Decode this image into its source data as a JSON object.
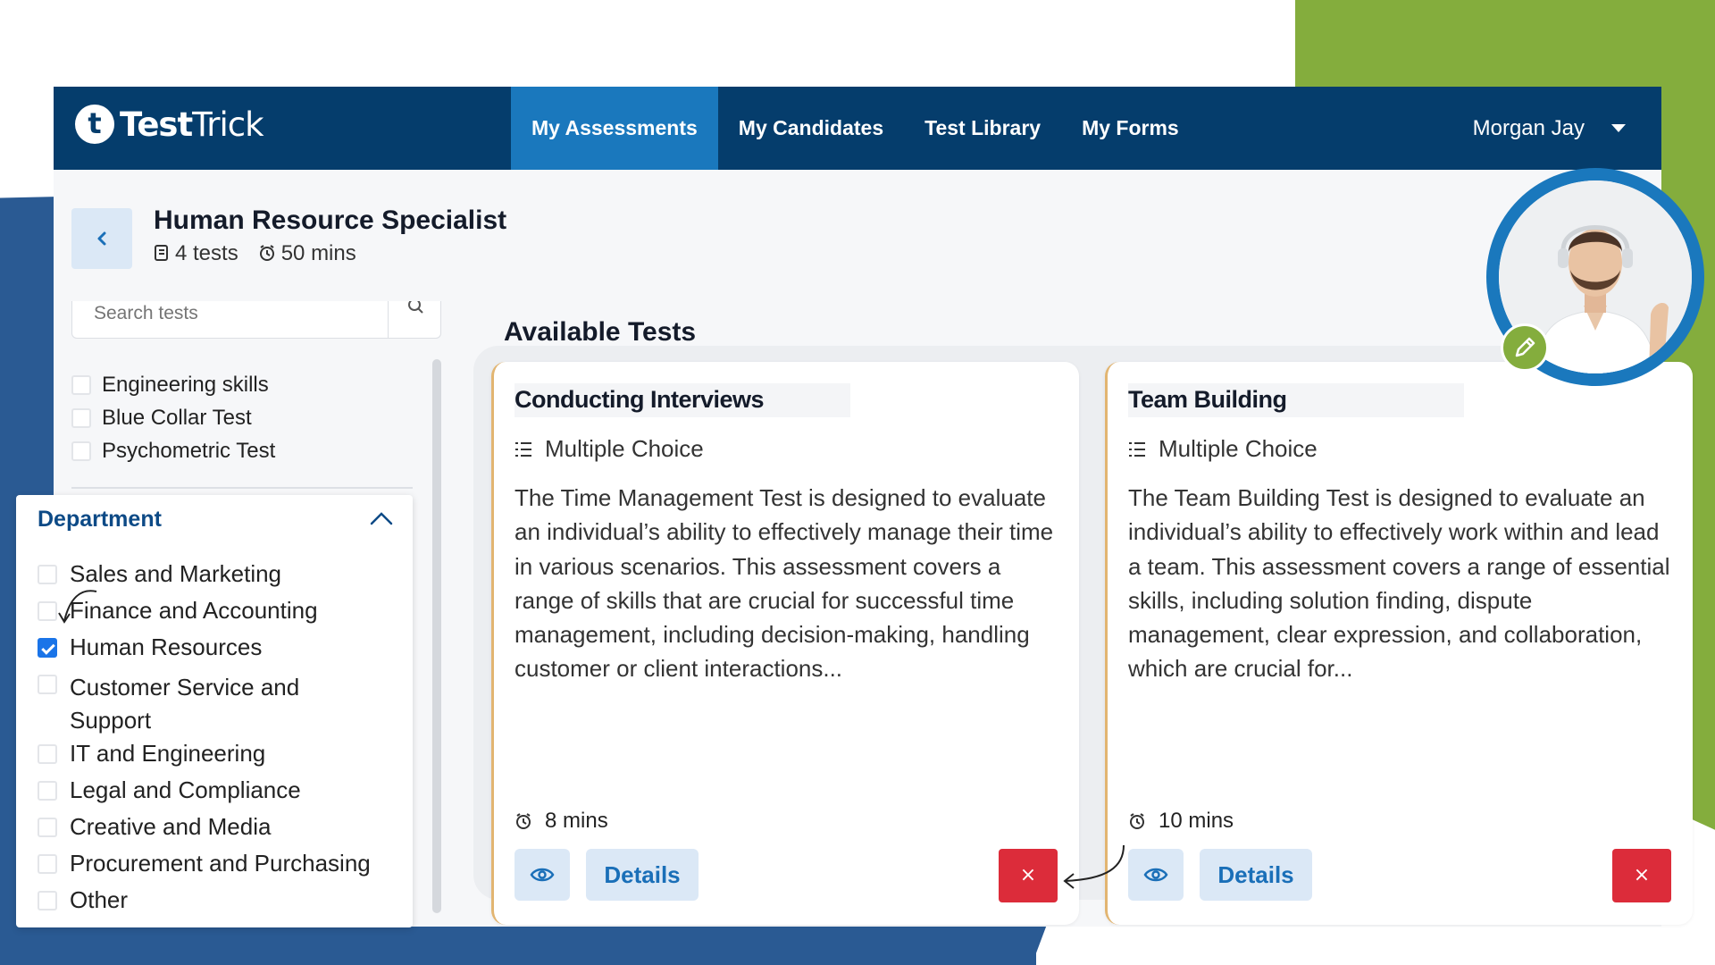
{
  "brand": {
    "logo_letter": "t",
    "name_bold": "Test",
    "name_rest": "Trick"
  },
  "nav": {
    "items": [
      {
        "label": "My Assessments",
        "active": true
      },
      {
        "label": "My Candidates",
        "active": false
      },
      {
        "label": "Test Library",
        "active": false
      },
      {
        "label": "My Forms",
        "active": false
      }
    ],
    "user_name": "Morgan Jay"
  },
  "header": {
    "title": "Human Resource Specialist",
    "tests_count": "4 tests",
    "duration": "50 mins"
  },
  "sidebar": {
    "search_placeholder": "Search tests",
    "test_types": [
      {
        "label": "Engineering skills",
        "checked": false
      },
      {
        "label": "Blue Collar Test",
        "checked": false
      },
      {
        "label": "Psychometric Test",
        "checked": false
      }
    ],
    "department": {
      "title": "Department",
      "items": [
        {
          "label": "Sales and Marketing",
          "checked": false
        },
        {
          "label": "Finance and Accounting",
          "checked": false
        },
        {
          "label": "Human Resources",
          "checked": true
        },
        {
          "label": "Customer Service and Support",
          "checked": false
        },
        {
          "label": "IT and Engineering",
          "checked": false
        },
        {
          "label": "Legal and Compliance",
          "checked": false
        },
        {
          "label": "Creative and Media",
          "checked": false
        },
        {
          "label": "Procurement and Purchasing",
          "checked": false
        },
        {
          "label": "Other",
          "checked": false
        }
      ]
    }
  },
  "main": {
    "section_title": "Available Tests",
    "cards": [
      {
        "title": "Conducting Interviews",
        "type": "Multiple Choice",
        "description": "The Time Management Test is designed to evaluate an individual’s ability to effectively manage their time in various scenarios. This assessment covers a range of skills that are crucial for successful time management, including decision-making, handling customer or client interactions...",
        "duration": "8 mins",
        "details_label": "Details",
        "remove_label": "×"
      },
      {
        "title": "Team Building",
        "type": "Multiple Choice",
        "description": "The Team Building Test is designed to evaluate an individual’s ability to effectively work within and lead a team. This assessment covers a range of essential skills, including solution finding, dispute management, clear expression, and collaboration, which are crucial for...",
        "duration": "10 mins",
        "details_label": "Details",
        "remove_label": "×"
      }
    ]
  },
  "colors": {
    "nav_bg": "#053d6c",
    "nav_active": "#1a78bd",
    "accent_blue": "#1a6fb8",
    "danger": "#dc2c3a",
    "green": "#84ad3d",
    "card_border": "#e2b571"
  },
  "icons": {
    "back": "chevron-left-icon",
    "tests": "clipboard-icon",
    "clock": "alarm-clock-icon",
    "search": "search-icon",
    "collapse": "chevron-up-icon",
    "list": "list-icon",
    "eye": "eye-icon",
    "remove": "close-icon",
    "edit": "pencil-icon"
  }
}
